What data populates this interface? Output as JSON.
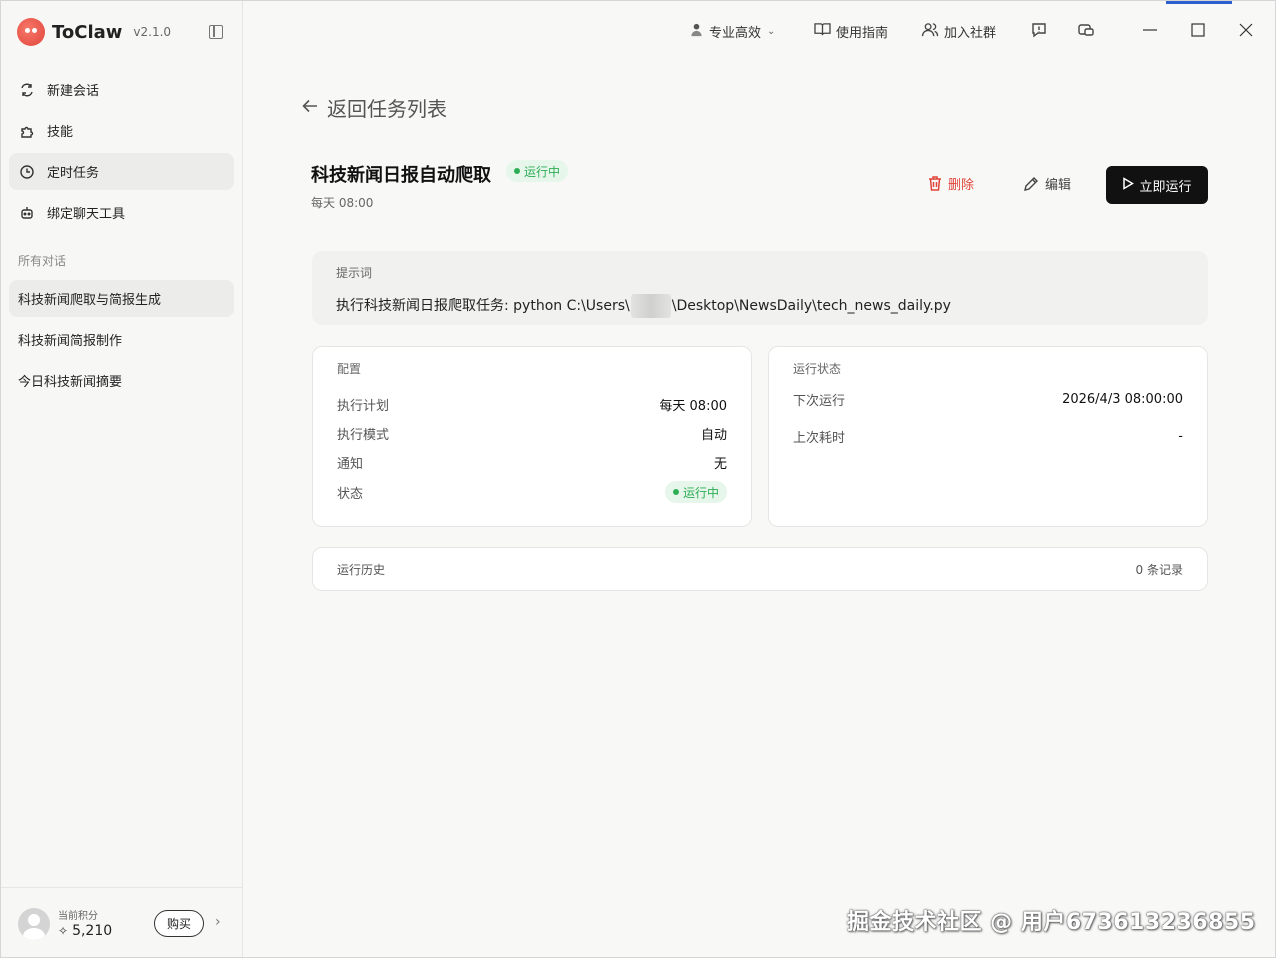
{
  "app": {
    "name": "ToClaw",
    "version": "v2.1.0"
  },
  "sidebar": {
    "nav": [
      {
        "label": "新建会话",
        "icon": "chat-refresh-icon"
      },
      {
        "label": "技能",
        "icon": "puzzle-icon"
      },
      {
        "label": "定时任务",
        "icon": "clock-icon",
        "active": true
      },
      {
        "label": "绑定聊天工具",
        "icon": "bot-icon"
      }
    ],
    "section_title": "所有对话",
    "conversations": [
      {
        "label": "科技新闻爬取与简报生成",
        "active": true
      },
      {
        "label": "科技新闻简报制作"
      },
      {
        "label": "今日科技新闻摘要"
      }
    ],
    "footer": {
      "points_label": "当前积分",
      "points_value": "5,210",
      "buy_label": "购买"
    }
  },
  "topbar": {
    "mode_label": "专业高效",
    "guide_label": "使用指南",
    "community_label": "加入社群"
  },
  "main": {
    "back_label": "返回任务列表",
    "task": {
      "title": "科技新闻日报自动爬取",
      "status_badge": "运行中",
      "schedule": "每天 08:00"
    },
    "actions": {
      "delete": "删除",
      "edit": "编辑",
      "run": "立即运行"
    },
    "prompt": {
      "label": "提示词",
      "text_before": "执行科技新闻日报爬取任务: python C:\\Users\\",
      "text_after": "\\Desktop\\NewsDaily\\tech_news_daily.py"
    },
    "config": {
      "title": "配置",
      "rows": [
        {
          "key": "执行计划",
          "value": "每天 08:00"
        },
        {
          "key": "执行模式",
          "value": "自动"
        },
        {
          "key": "通知",
          "value": "无"
        },
        {
          "key": "状态",
          "value": "运行中"
        }
      ]
    },
    "run_status": {
      "title": "运行状态",
      "rows": [
        {
          "key": "下次运行",
          "value": "2026/4/3 08:00:00"
        },
        {
          "key": "上次耗时",
          "value": "-"
        }
      ]
    },
    "history": {
      "title": "运行历史",
      "count": "0 条记录"
    }
  },
  "watermark": "掘金技术社区 @ 用户673613236855",
  "colors": {
    "status_green": "#2cae55",
    "danger_red": "#e0443a",
    "primary_dark": "#111111"
  }
}
